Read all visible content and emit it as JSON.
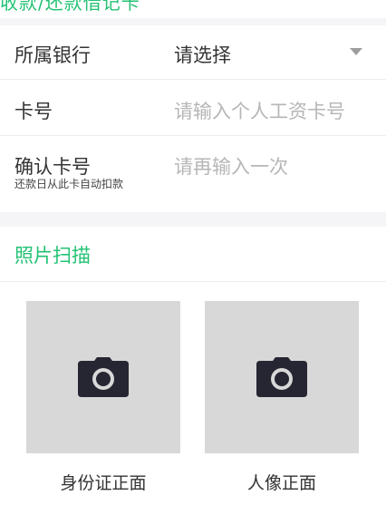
{
  "header": {
    "title": "收款/还款借记卡"
  },
  "form": {
    "bank": {
      "label": "所属银行",
      "value": "请选择"
    },
    "card_no": {
      "label": "卡号",
      "placeholder": "请输入个人工资卡号"
    },
    "confirm": {
      "label": "确认卡号",
      "placeholder": "请再输入一次",
      "hint": "还款日从此卡自动扣款"
    }
  },
  "photo": {
    "title": "照片扫描",
    "tiles": [
      {
        "caption": "身份证正面",
        "icon": "camera-icon"
      },
      {
        "caption": "人像正面",
        "icon": "camera-icon"
      }
    ]
  },
  "colors": {
    "accent": "#23c274",
    "placeholder": "#b6b6b6",
    "tile_bg": "#d8d8d8",
    "icon": "#262633"
  }
}
